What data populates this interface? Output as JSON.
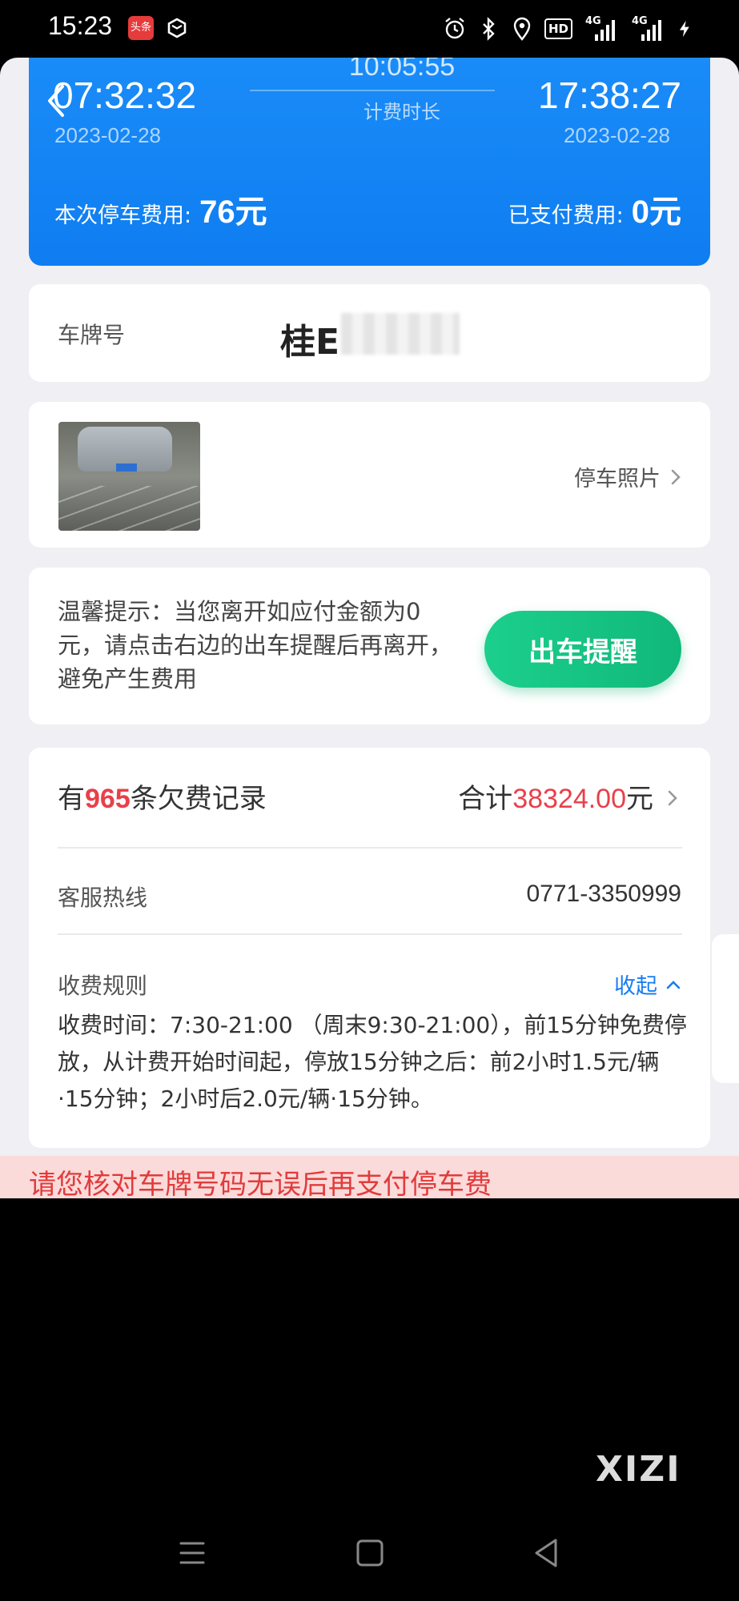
{
  "status_bar": {
    "time": "15:23",
    "app_badge": "头条",
    "icons": [
      "alarm-icon",
      "bluetooth-icon",
      "location-icon",
      "hd-icon",
      "signal-4g-icon",
      "signal-4g-icon",
      "charging-icon"
    ],
    "hd_label": "HD",
    "net1": "4G",
    "net2": "4G"
  },
  "parking": {
    "start_time": "07:32:32",
    "start_date": "2023-02-28",
    "duration": "10:05:55",
    "duration_label": "计费时长",
    "end_time": "17:38:27",
    "end_date": "2023-02-28",
    "fee_label": "本次停车费用:",
    "fee_value": "76元",
    "paid_label": "已支付费用:",
    "paid_value": "0元"
  },
  "plate": {
    "label": "车牌号",
    "value": "桂E"
  },
  "photo": {
    "link_label": "停车照片"
  },
  "tip": {
    "text": "温馨提示：当您离开如应付金额为0元，请点击右边的出车提醒后再离开，避免产生费用",
    "button": "出车提醒"
  },
  "arrears": {
    "prefix": "有",
    "count": "965",
    "suffix": "条欠费记录",
    "total_prefix": "合计",
    "total_amount": "38324.00",
    "total_suffix": "元"
  },
  "hotline": {
    "label": "客服热线",
    "value": "0771-3350999"
  },
  "rules": {
    "label": "收费规则",
    "collapse": "收起",
    "text": "收费时间：7:30-21:00 （周末9:30-21:00），前15分钟免费停放，从计费开始时间起，停放15分钟之后：前2小时1.5元/辆·15分钟；2小时后2.0元/辆·15分钟。"
  },
  "warning": {
    "text": "请您核对车牌号码无误后再支付停车费"
  },
  "watermark": "XIZI",
  "colors": {
    "primary_blue": "#1a8cf8",
    "accent_green": "#1ccf8c",
    "alert_red": "#e8404a",
    "link_blue": "#1a7df0"
  }
}
